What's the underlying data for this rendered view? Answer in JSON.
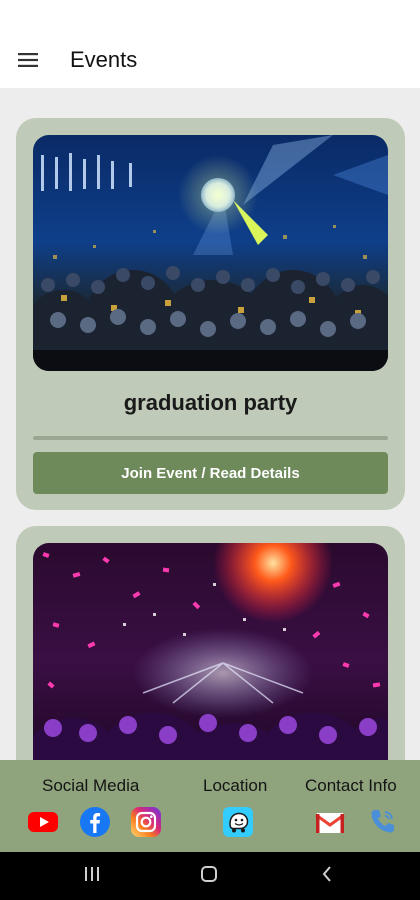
{
  "app_bar": {
    "title": "Events"
  },
  "events": [
    {
      "title": "graduation party",
      "button_label": "Join Event / Read Details"
    },
    {
      "title": "",
      "button_label": ""
    }
  ],
  "footer": {
    "social_label": "Social Media",
    "location_label": "Location",
    "contact_label": "Contact Info",
    "icons": [
      "youtube-icon",
      "facebook-icon",
      "instagram-icon",
      "waze-icon",
      "gmail-icon",
      "phone-icon"
    ]
  },
  "colors": {
    "card_bg": "#bfcbb8",
    "button_bg": "#6e8a5b",
    "footer_bg": "#8fa37c"
  }
}
